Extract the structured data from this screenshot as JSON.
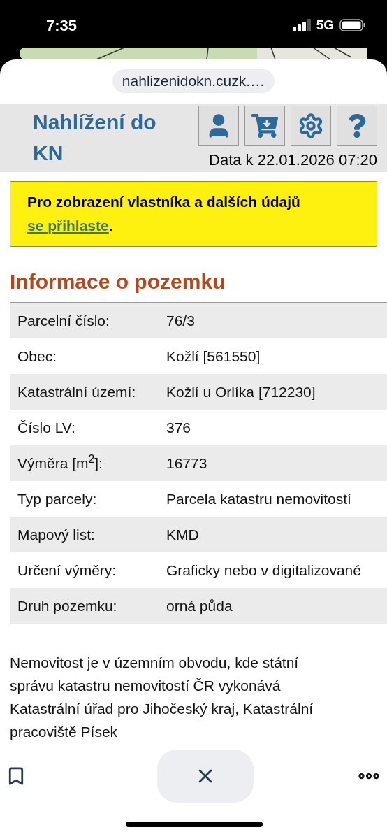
{
  "status_bar": {
    "time": "7:35",
    "network": "5G"
  },
  "browser": {
    "url": "nahlizenidokn.cuzk.…"
  },
  "header": {
    "title": "Nahlížení do KN",
    "data_date": "Data k 22.01.2026 07:20"
  },
  "notice": {
    "text": "Pro zobrazení vlastníka a dalších údajů",
    "link": "se přihlaste",
    "end": "."
  },
  "section_title": "Informace o pozemku",
  "rows": [
    {
      "label": "Parcelní číslo:",
      "value": "76/3"
    },
    {
      "label": "Obec:",
      "value": "Kožlí [561550]"
    },
    {
      "label": "Katastrální území:",
      "value": "Kožlí u Orlíka [712230]"
    },
    {
      "label": "Číslo LV:",
      "value": "376"
    },
    {
      "label": "Výměra [m$^{2}$]:",
      "value": "16773"
    },
    {
      "label": "Typ parcely:",
      "value": "Parcela katastru nemovitostí"
    },
    {
      "label": "Mapový list:",
      "value": "KMD"
    },
    {
      "label": "Určení výměry:",
      "value": "Graficky nebo v digitalizované"
    },
    {
      "label": "Druh pozemku:",
      "value": "orná půda"
    }
  ],
  "paragraph": "Nemovitost je v územním obvodu, kde státní správu katastru nemovitostí ČR vykonává Katastrální úřad pro Jihočeský kraj, Katastrální pracoviště Písek"
}
